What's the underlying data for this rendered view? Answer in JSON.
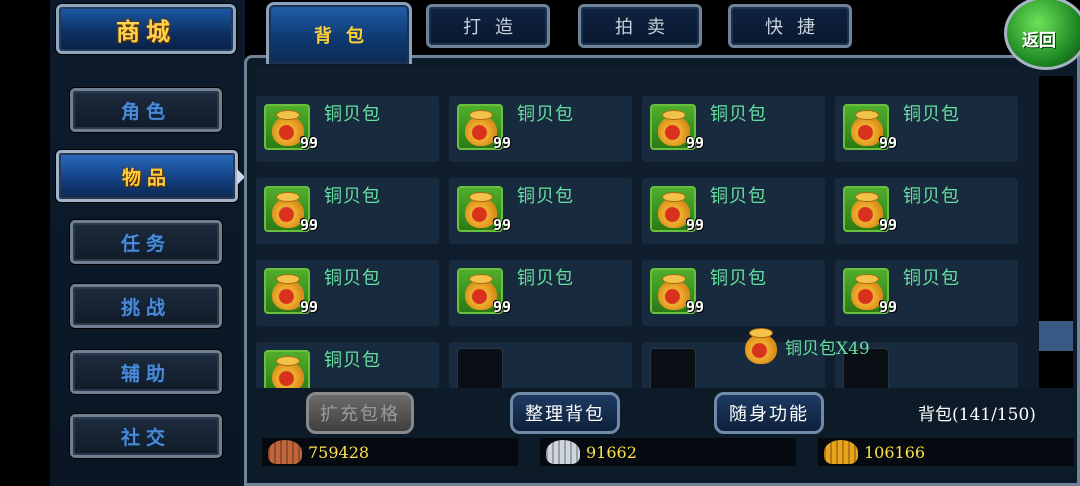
{
  "sidebar": {
    "shop_label": "商城",
    "items": [
      {
        "label": "角色",
        "active": false
      },
      {
        "label": "物品",
        "active": true
      },
      {
        "label": "任务",
        "active": false
      },
      {
        "label": "挑战",
        "active": false
      },
      {
        "label": "辅助",
        "active": false
      },
      {
        "label": "社交",
        "active": false
      }
    ]
  },
  "tabs": [
    {
      "label": "背包",
      "active": true
    },
    {
      "label": "打造",
      "active": false
    },
    {
      "label": "拍卖",
      "active": false
    },
    {
      "label": "快捷",
      "active": false
    }
  ],
  "back_label": "返回",
  "inventory": {
    "items": [
      {
        "name": "铜贝包",
        "qty": "99"
      },
      {
        "name": "铜贝包",
        "qty": "99"
      },
      {
        "name": "铜贝包",
        "qty": "99"
      },
      {
        "name": "铜贝包",
        "qty": "99"
      },
      {
        "name": "铜贝包",
        "qty": "99"
      },
      {
        "name": "铜贝包",
        "qty": "99"
      },
      {
        "name": "铜贝包",
        "qty": "99"
      },
      {
        "name": "铜贝包",
        "qty": "99"
      },
      {
        "name": "铜贝包",
        "qty": "99"
      },
      {
        "name": "铜贝包",
        "qty": "99"
      },
      {
        "name": "铜贝包",
        "qty": "99"
      },
      {
        "name": "铜贝包",
        "qty": "99"
      },
      {
        "name": "铜贝包",
        "qty": ""
      },
      {
        "name": "",
        "qty": ""
      },
      {
        "name": "",
        "qty": ""
      },
      {
        "name": "",
        "qty": ""
      }
    ],
    "scroll_position": 0.87
  },
  "tooltip": {
    "text": "铜贝包X49"
  },
  "footer": {
    "expand_label": "扩充包格",
    "sort_label": "整理背包",
    "portable_label": "随身功能",
    "capacity": "背包(141/150)"
  },
  "currency": [
    {
      "value": "759428",
      "color": "#c0663a"
    },
    {
      "value": "91662",
      "color": "#cfd6de"
    },
    {
      "value": "106166",
      "color": "#e8a41c"
    }
  ]
}
